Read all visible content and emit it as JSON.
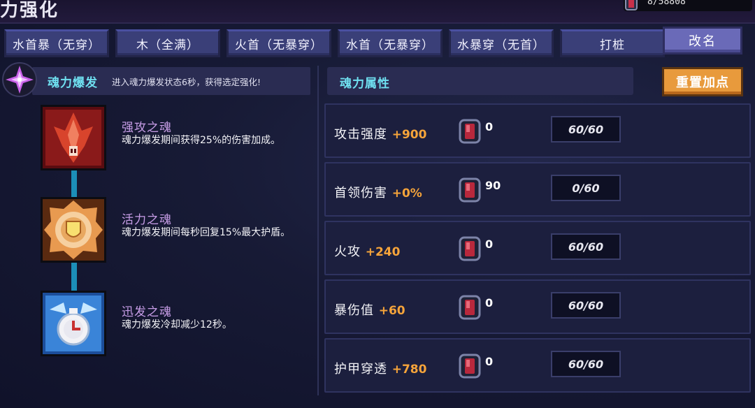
{
  "header": {
    "title": "力强化",
    "currency_amount": "8/58808"
  },
  "tabs": [
    {
      "label": "水首暴（无穿）"
    },
    {
      "label": "木（全满）"
    },
    {
      "label": "火首（无暴穿）"
    },
    {
      "label": "水首（无暴穿）"
    },
    {
      "label": "水暴穿（无首）"
    },
    {
      "label": "打桩"
    }
  ],
  "rename_label": "改名",
  "burst": {
    "title": "魂力爆发",
    "description": "进入魂力爆发状态6秒，获得选定强化!"
  },
  "souls": [
    {
      "name": "强攻之魂",
      "description": "魂力爆发期间获得25%的伤害加成。",
      "icon": "attack-soul-icon"
    },
    {
      "name": "活力之魂",
      "description": "魂力爆发期间每秒回复15%最大护盾。",
      "icon": "vitality-soul-icon"
    },
    {
      "name": "迅发之魂",
      "description": "魂力爆发冷却减少12秒。",
      "icon": "swift-soul-icon"
    }
  ],
  "attributes_title": "魂力属性",
  "reset_label": "重置加点",
  "attributes": [
    {
      "name": "攻击强度",
      "bonus": "+900",
      "spent": "0",
      "level": "60/60"
    },
    {
      "name": "首领伤害",
      "bonus": "+0%",
      "spent": "90",
      "level": "0/60"
    },
    {
      "name": "火攻",
      "bonus": "+240",
      "spent": "0",
      "level": "60/60"
    },
    {
      "name": "暴伤值",
      "bonus": "+60",
      "spent": "0",
      "level": "60/60"
    },
    {
      "name": "护甲穿透",
      "bonus": "+780",
      "spent": "0",
      "level": "60/60"
    }
  ],
  "colors": {
    "accent_cyan": "#6fe0f0",
    "bonus_orange": "#f6a43a",
    "soul_name_purple": "#c89ee8",
    "reset_button": "#e89a3c"
  }
}
